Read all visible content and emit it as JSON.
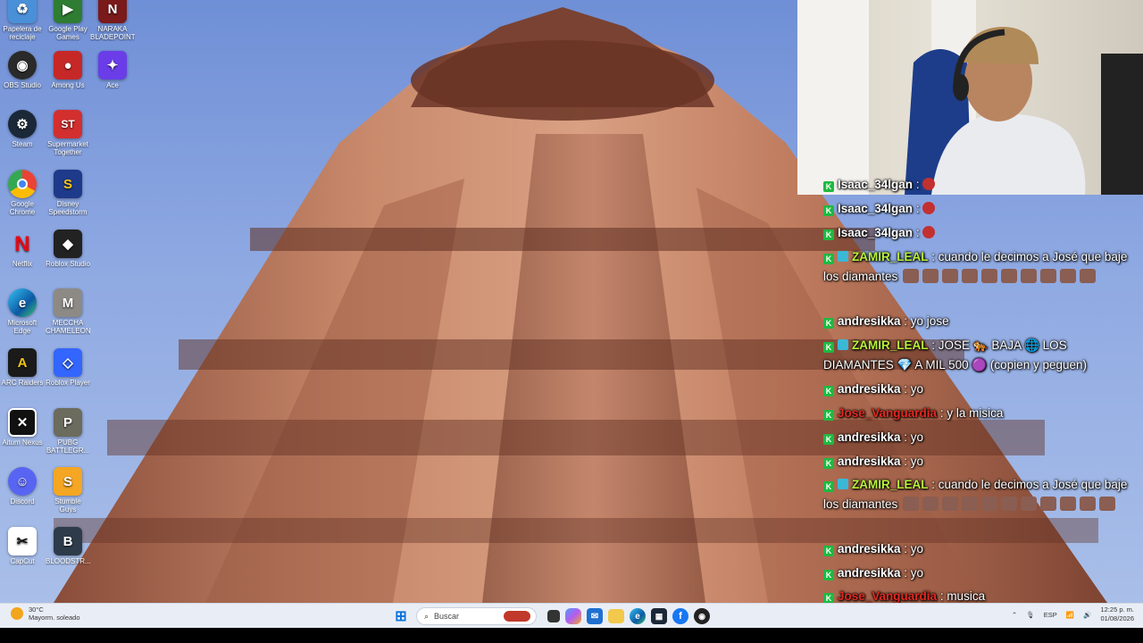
{
  "desktop_icons": [
    {
      "label": "Papelera de reciclaje",
      "icon": "recycle-bin-icon",
      "color": "#4a90d9",
      "glyph": "♻"
    },
    {
      "label": "Google Play Games",
      "icon": "google-play-games-icon",
      "color": "#2e7d32",
      "glyph": "▶"
    },
    {
      "label": "NARAKA BLADEPOINT",
      "icon": "naraka-icon",
      "color": "#7a1a1a",
      "glyph": "N"
    },
    {
      "label": "OBS Studio",
      "icon": "obs-icon",
      "color": "#2a2a2a",
      "glyph": "◉"
    },
    {
      "label": "Among Us",
      "icon": "among-us-icon",
      "color": "#c62828",
      "glyph": "●"
    },
    {
      "label": "Ace",
      "icon": "ace-icon",
      "color": "#6a3de8",
      "glyph": "✦"
    },
    {
      "label": "Steam",
      "icon": "steam-icon",
      "color": "#1b2838",
      "glyph": "⚙"
    },
    {
      "label": "Supermarket Together",
      "icon": "supermarket-together-icon",
      "color": "#d32f2f",
      "glyph": "ST"
    },
    {
      "label": "Google Chrome",
      "icon": "chrome-icon",
      "color": "#fbbc05",
      "glyph": "◎"
    },
    {
      "label": "Disney Speedstorm",
      "icon": "disney-speedstorm-icon",
      "color": "#1e3a8a",
      "glyph": "S"
    },
    {
      "label": "Netflix",
      "icon": "netflix-icon",
      "color": "#111111",
      "glyph": "N"
    },
    {
      "label": "Roblox Studio",
      "icon": "roblox-studio-icon",
      "color": "#222222",
      "glyph": "◆"
    },
    {
      "label": "Microsoft Edge",
      "icon": "edge-icon",
      "color": "#1f8ad1",
      "glyph": "e"
    },
    {
      "label": "MECCHA CHAMELEON",
      "icon": "meccha-chameleon-icon",
      "color": "#8d8a86",
      "glyph": "M"
    },
    {
      "label": "ARC Raiders",
      "icon": "arc-raiders-icon",
      "color": "#1a1a1a",
      "glyph": "A"
    },
    {
      "label": "Roblox Player",
      "icon": "roblox-player-icon",
      "color": "#3366ff",
      "glyph": "◇"
    },
    {
      "label": "Aitum Nexus",
      "icon": "aitum-nexus-icon",
      "color": "#111111",
      "glyph": "✕"
    },
    {
      "label": "PUBG BATTLEGR...",
      "icon": "pubg-icon",
      "color": "#6b6b5e",
      "glyph": "P"
    },
    {
      "label": "Discord",
      "icon": "discord-icon",
      "color": "#5865f2",
      "glyph": "☺"
    },
    {
      "label": "Stumble Guys",
      "icon": "stumble-guys-icon",
      "color": "#f5a623",
      "glyph": "S"
    },
    {
      "label": "CapCut",
      "icon": "capcut-icon",
      "color": "#111111",
      "glyph": "✂"
    },
    {
      "label": "BLOODSTR...",
      "icon": "bloodstrike-icon",
      "color": "#2d3b4a",
      "glyph": "B"
    }
  ],
  "chat": {
    "messages": [
      {
        "user": "Isaac_34lgan",
        "color": "#ffffff",
        "text": " : ",
        "rose": true
      },
      {
        "user": "Isaac_34lgan",
        "color": "#ffffff",
        "text": " : ",
        "rose": true
      },
      {
        "user": "Isaac_34lgan",
        "color": "#ffffff",
        "text": " : ",
        "rose": true
      },
      {
        "user": "ZAMIR_LEAL",
        "color": "#b7f23a",
        "text": " : cuando le decimos a José que baje los diamantes",
        "emotes": 10,
        "extra_badge": true
      },
      {
        "user": "andresikka",
        "color": "#ffffff",
        "text": " : yo jose"
      },
      {
        "user": "ZAMIR_LEAL",
        "color": "#b7f23a",
        "text": " : JOSE 🐅 BAJA 🌐 LOS DIAMANTES 💎 A MIL 500 🟣 (copien y peguen)",
        "extra_badge": true
      },
      {
        "user": "andresikka",
        "color": "#ffffff",
        "text": " : yo"
      },
      {
        "user": "Jose_Vanguardia",
        "color": "#e0291f",
        "text": " : y la misica"
      },
      {
        "user": "andresikka",
        "color": "#ffffff",
        "text": " : yo"
      },
      {
        "user": "andresikka",
        "color": "#ffffff",
        "text": " : yo"
      },
      {
        "user": "ZAMIR_LEAL",
        "color": "#b7f23a",
        "text": " : cuando le decimos a José que baje los diamantes",
        "emotes": 11,
        "extra_badge": true
      },
      {
        "user": "andresikka",
        "color": "#ffffff",
        "text": " : yo"
      },
      {
        "user": "andresikka",
        "color": "#ffffff",
        "text": " : yo"
      },
      {
        "user": "Jose_Vanguardia",
        "color": "#e0291f",
        "text": " : musica"
      }
    ]
  },
  "taskbar": {
    "weather_temp": "30°C",
    "weather_desc": "Mayorm. soleado",
    "search_placeholder": "Buscar",
    "language": "ESP",
    "time": "12:25 p. m.",
    "date": "01/08/2026"
  }
}
